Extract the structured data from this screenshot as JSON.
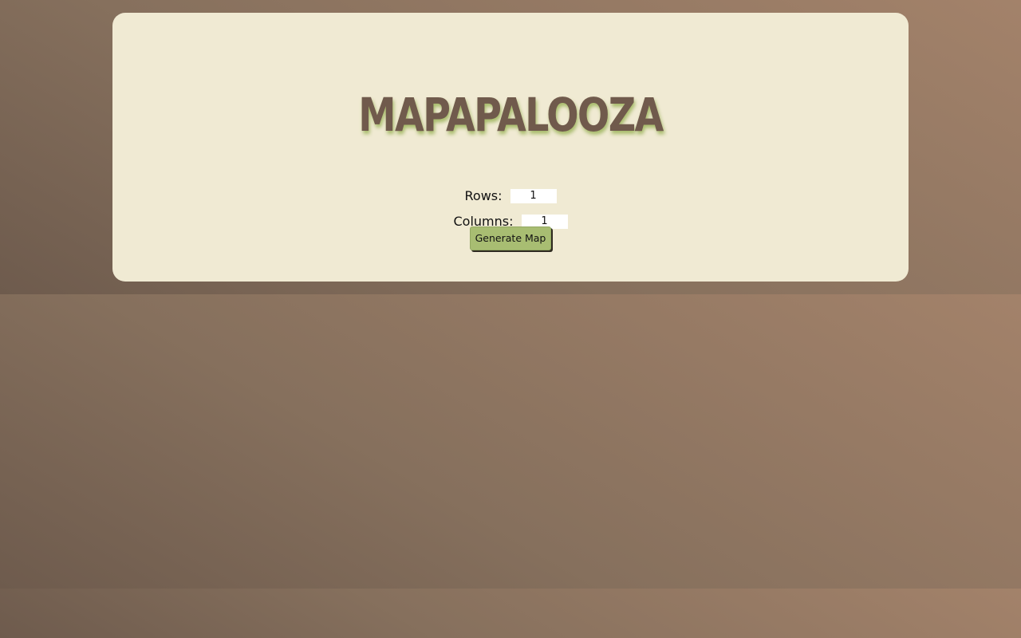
{
  "header": {
    "title": "MAPAPALOOZA"
  },
  "form": {
    "rows_label": "Rows:",
    "rows_value": "1",
    "columns_label": "Columns:",
    "columns_value": "1",
    "generate_label": "Generate Map"
  },
  "colors": {
    "background_dark": "#6e5b4d",
    "background_light": "#a3826a",
    "card": "#f0ead3",
    "title": "#705a4c",
    "title_shadow": "#a8bc6c",
    "button": "#a8bd72"
  }
}
